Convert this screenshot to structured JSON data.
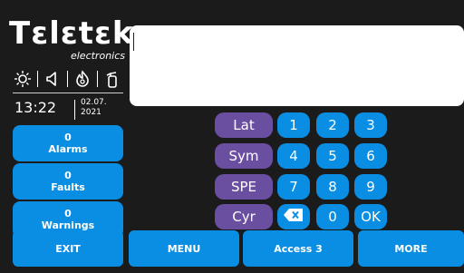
{
  "brand": {
    "logo": "Tεlεtεk",
    "sub": "electronics"
  },
  "status_icons": [
    "sun-icon",
    "speaker-icon",
    "flame-icon",
    "fire-extinguisher-icon"
  ],
  "clock": {
    "time": "13:22",
    "date_line1": "02.07.",
    "date_line2": "2021"
  },
  "display": {
    "text": ""
  },
  "counters": [
    {
      "count": "0",
      "label": "Alarms"
    },
    {
      "count": "0",
      "label": "Faults"
    },
    {
      "count": "0",
      "label": "Warnings"
    }
  ],
  "keypad": {
    "lang_keys": [
      "Lat",
      "Sym",
      "SPE",
      "Cyr"
    ],
    "rows": [
      [
        "1",
        "2",
        "3"
      ],
      [
        "4",
        "5",
        "6"
      ],
      [
        "7",
        "8",
        "9"
      ],
      [
        "backspace",
        "0",
        "OK"
      ]
    ]
  },
  "bottom_bar": {
    "exit": "EXIT",
    "menu": "MENU",
    "access": "Access 3",
    "more": "MORE"
  },
  "colors": {
    "background": "#1b1b1b",
    "blue": "#0a8ee3",
    "purple": "#6a4fa1",
    "white": "#ffffff"
  }
}
